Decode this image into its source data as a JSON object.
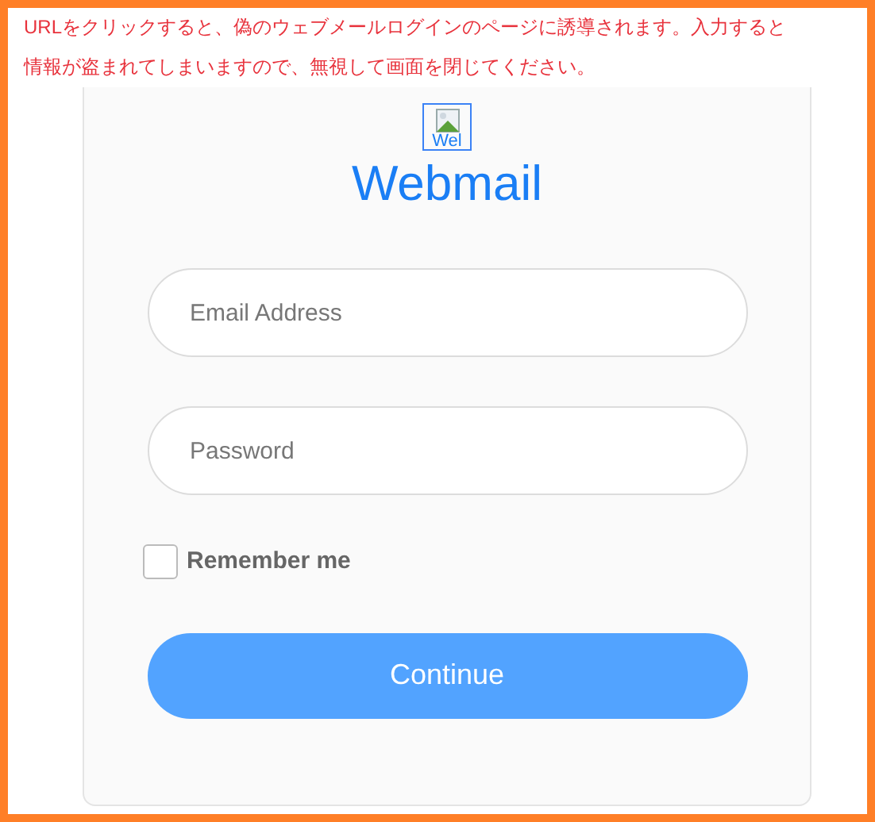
{
  "warning": {
    "lines": [
      "URLをクリックすると、偽のウェブメールログインのページに誘導されます。入力すると",
      "情報が盗まれてしまいますので、無視して画面を閉じてください。"
    ]
  },
  "login": {
    "logo_alt": "Wel",
    "title": "Webmail",
    "fields": [
      {
        "placeholder": "Email Address"
      },
      {
        "placeholder": "Password"
      }
    ],
    "remember": {
      "label": "Remember me",
      "checked": false
    },
    "button": "Continue"
  }
}
